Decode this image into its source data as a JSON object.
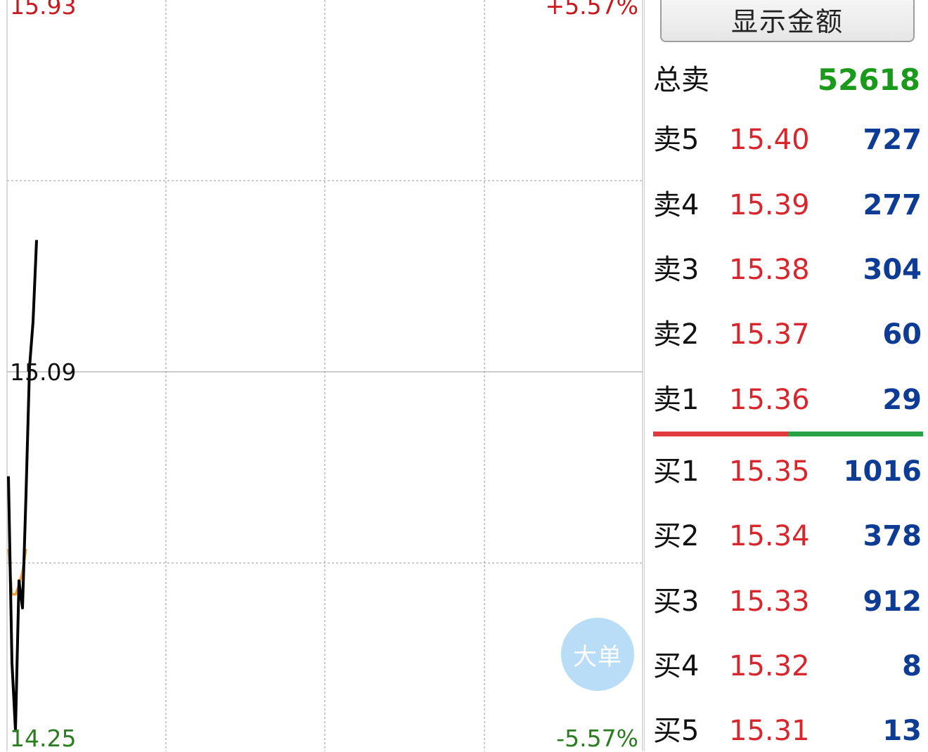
{
  "chart": {
    "price_high": "15.93",
    "price_mid": "15.09",
    "price_low": "14.25",
    "pct_high": "+5.57%",
    "pct_low": "-5.57%",
    "big_order_label": "大单",
    "colors": {
      "price_line": "#000000",
      "avg_line": "#f4a12a",
      "up": "#c8191e",
      "down": "#2a7d1f"
    }
  },
  "chart_data": {
    "type": "line",
    "ylim": [
      14.25,
      15.93
    ],
    "series": [
      {
        "values": [
          14.86,
          14.45,
          14.3,
          14.63,
          14.57,
          14.82,
          15.1,
          15.2,
          15.38
        ]
      },
      {
        "values": [
          14.7,
          14.6,
          14.6,
          14.62,
          14.65,
          14.7
        ]
      }
    ]
  },
  "orderbook": {
    "toggle_label": "显示金额",
    "total_sell_label": "总卖",
    "total_sell_value": "52618",
    "sell_buy_ratio": 0.5,
    "sells": [
      {
        "label": "卖5",
        "price": "15.40",
        "volume": "727"
      },
      {
        "label": "卖4",
        "price": "15.39",
        "volume": "277"
      },
      {
        "label": "卖3",
        "price": "15.38",
        "volume": "304"
      },
      {
        "label": "卖2",
        "price": "15.37",
        "volume": "60"
      },
      {
        "label": "卖1",
        "price": "15.36",
        "volume": "29"
      }
    ],
    "buys": [
      {
        "label": "买1",
        "price": "15.35",
        "volume": "1016"
      },
      {
        "label": "买2",
        "price": "15.34",
        "volume": "378"
      },
      {
        "label": "买3",
        "price": "15.33",
        "volume": "912"
      },
      {
        "label": "买4",
        "price": "15.32",
        "volume": "8"
      },
      {
        "label": "买5",
        "price": "15.31",
        "volume": "13"
      }
    ]
  }
}
